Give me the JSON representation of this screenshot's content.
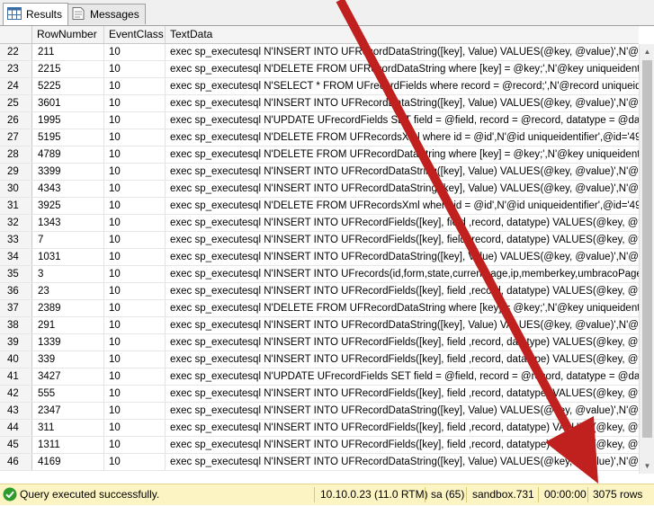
{
  "tabs": [
    {
      "label": "Results",
      "icon": "grid-icon",
      "active": true
    },
    {
      "label": "Messages",
      "icon": "messages-icon",
      "active": false
    }
  ],
  "grid": {
    "columns": [
      "RowNumber",
      "EventClass",
      "TextData"
    ],
    "rows": [
      {
        "num": "22",
        "rownumber": "211",
        "eventclass": "10",
        "textdata": "exec sp_executesql N'INSERT INTO UFRecordDataString([key], Value) VALUES(@key, @value)',N'@value"
      },
      {
        "num": "23",
        "rownumber": "2215",
        "eventclass": "10",
        "textdata": "exec sp_executesql N'DELETE FROM UFRecordDataString where [key] = @key;',N'@key uniqueidentifier',@"
      },
      {
        "num": "24",
        "rownumber": "5225",
        "eventclass": "10",
        "textdata": "exec sp_executesql N'SELECT * FROM UFrecordFields where record = @record;',N'@record uniqueidentifier'"
      },
      {
        "num": "25",
        "rownumber": "3601",
        "eventclass": "10",
        "textdata": "exec sp_executesql N'INSERT INTO UFRecordDataString([key], Value) VALUES(@key, @value)',N'@value"
      },
      {
        "num": "26",
        "rownumber": "1995",
        "eventclass": "10",
        "textdata": "exec sp_executesql N'UPDATE UFrecordFields SET field = @field, record = @record, datatype = @datatype"
      },
      {
        "num": "27",
        "rownumber": "5195",
        "eventclass": "10",
        "textdata": "exec sp_executesql N'DELETE FROM UFRecordsXml where id = @id',N'@id uniqueidentifier',@id='493A9DD"
      },
      {
        "num": "28",
        "rownumber": "4789",
        "eventclass": "10",
        "textdata": "exec sp_executesql N'DELETE FROM UFRecordDataString where [key] = @key;',N'@key uniqueidentifier',@"
      },
      {
        "num": "29",
        "rownumber": "3399",
        "eventclass": "10",
        "textdata": "exec sp_executesql N'INSERT INTO UFRecordDataString([key], Value) VALUES(@key, @value)',N'@value"
      },
      {
        "num": "30",
        "rownumber": "4343",
        "eventclass": "10",
        "textdata": "exec sp_executesql N'INSERT INTO UFRecordDataString([key], Value) VALUES(@key, @value)',N'@value"
      },
      {
        "num": "31",
        "rownumber": "3925",
        "eventclass": "10",
        "textdata": "exec sp_executesql N'DELETE FROM UFRecordsXml where id = @id',N'@id uniqueidentifier',@id='493A9DD"
      },
      {
        "num": "32",
        "rownumber": "1343",
        "eventclass": "10",
        "textdata": "exec sp_executesql N'INSERT INTO UFRecordFields([key], field ,record, datatype) VALUES(@key, @field, @"
      },
      {
        "num": "33",
        "rownumber": "7",
        "eventclass": "10",
        "textdata": "exec sp_executesql N'INSERT INTO UFRecordFields([key], field ,record, datatype) VALUES(@key, @field, @"
      },
      {
        "num": "34",
        "rownumber": "1031",
        "eventclass": "10",
        "textdata": "exec sp_executesql N'INSERT INTO UFRecordDataString([key], Value) VALUES(@key, @value)',N'@value"
      },
      {
        "num": "35",
        "rownumber": "3",
        "eventclass": "10",
        "textdata": "exec sp_executesql N'INSERT INTO UFrecords(id,form,state,currentpage,ip,memberkey,umbracoPageId,upda"
      },
      {
        "num": "36",
        "rownumber": "23",
        "eventclass": "10",
        "textdata": "exec sp_executesql N'INSERT INTO UFRecordFields([key], field ,record, datatype) VALUES(@key, @field, @"
      },
      {
        "num": "37",
        "rownumber": "2389",
        "eventclass": "10",
        "textdata": "exec sp_executesql N'DELETE FROM UFRecordDataString where [key] = @key;',N'@key uniqueidentifier',@"
      },
      {
        "num": "38",
        "rownumber": "291",
        "eventclass": "10",
        "textdata": "exec sp_executesql N'INSERT INTO UFRecordDataString([key], Value) VALUES(@key, @value)',N'@value"
      },
      {
        "num": "39",
        "rownumber": "1339",
        "eventclass": "10",
        "textdata": "exec sp_executesql N'INSERT INTO UFRecordFields([key], field ,record, datatype) VALUES(@key, @field, @"
      },
      {
        "num": "40",
        "rownumber": "339",
        "eventclass": "10",
        "textdata": "exec sp_executesql N'INSERT INTO UFRecordFields([key], field ,record, datatype) VALUES(@key, @field, @"
      },
      {
        "num": "41",
        "rownumber": "3427",
        "eventclass": "10",
        "textdata": "exec sp_executesql N'UPDATE UFrecordFields SET field = @field, record = @record, datatype = @datatype"
      },
      {
        "num": "42",
        "rownumber": "555",
        "eventclass": "10",
        "textdata": "exec sp_executesql N'INSERT INTO UFRecordFields([key], field ,record, datatype) VALUES(@key, @field, @"
      },
      {
        "num": "43",
        "rownumber": "2347",
        "eventclass": "10",
        "textdata": "exec sp_executesql N'INSERT INTO UFRecordDataString([key], Value) VALUES(@key, @value)',N'@value"
      },
      {
        "num": "44",
        "rownumber": "311",
        "eventclass": "10",
        "textdata": "exec sp_executesql N'INSERT INTO UFRecordFields([key], field ,record, datatype) VALUES(@key, @field, @"
      },
      {
        "num": "45",
        "rownumber": "1311",
        "eventclass": "10",
        "textdata": "exec sp_executesql N'INSERT INTO UFRecordFields([key], field ,record, datatype) VALUES(@key, @field, @"
      },
      {
        "num": "46",
        "rownumber": "4169",
        "eventclass": "10",
        "textdata": "exec sp_executesql N'INSERT INTO UFRecordDataString([key], Value) VALUES(@key, @value)',N'@value"
      }
    ]
  },
  "status": {
    "message": "Query executed successfully.",
    "server": "10.10.0.23 (11.0 RTM)",
    "user": "sa (65)",
    "database": "sandbox.731",
    "elapsed": "00:00:00",
    "rowcount": "3075 rows"
  },
  "colors": {
    "status_bar": "#fdf4c3",
    "success": "#2e9b2e",
    "annotation_arrow": "#c0201e"
  }
}
